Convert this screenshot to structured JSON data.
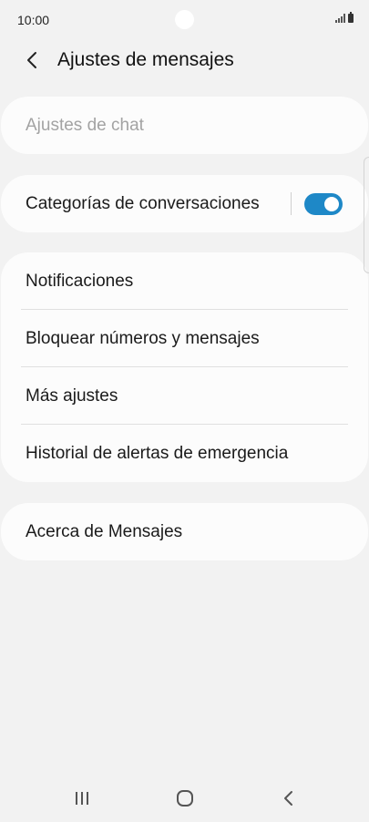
{
  "status_bar": {
    "time": "10:00",
    "icons": [
      "signal-icon",
      "battery-icon"
    ]
  },
  "header": {
    "back_icon": "chevron-left-icon",
    "title": "Ajustes de mensajes"
  },
  "sections": {
    "chat": {
      "label": "Ajustes de chat",
      "enabled": false
    },
    "categories": {
      "label": "Categorías de conversaciones",
      "toggle_on": true
    },
    "main": {
      "items": [
        {
          "label": "Notificaciones"
        },
        {
          "label": "Bloquear números y mensajes"
        },
        {
          "label": "Más ajustes"
        },
        {
          "label": "Historial de alertas de emergencia"
        }
      ]
    },
    "about": {
      "label": "Acerca de Mensajes"
    }
  },
  "nav_bar": {
    "icons": [
      "recent-apps-icon",
      "home-icon",
      "back-icon"
    ]
  },
  "colors": {
    "background": "#f2f2f2",
    "card": "#fcfcfc",
    "accent": "#1e88c7",
    "disabled_text": "#a3a3a3"
  }
}
